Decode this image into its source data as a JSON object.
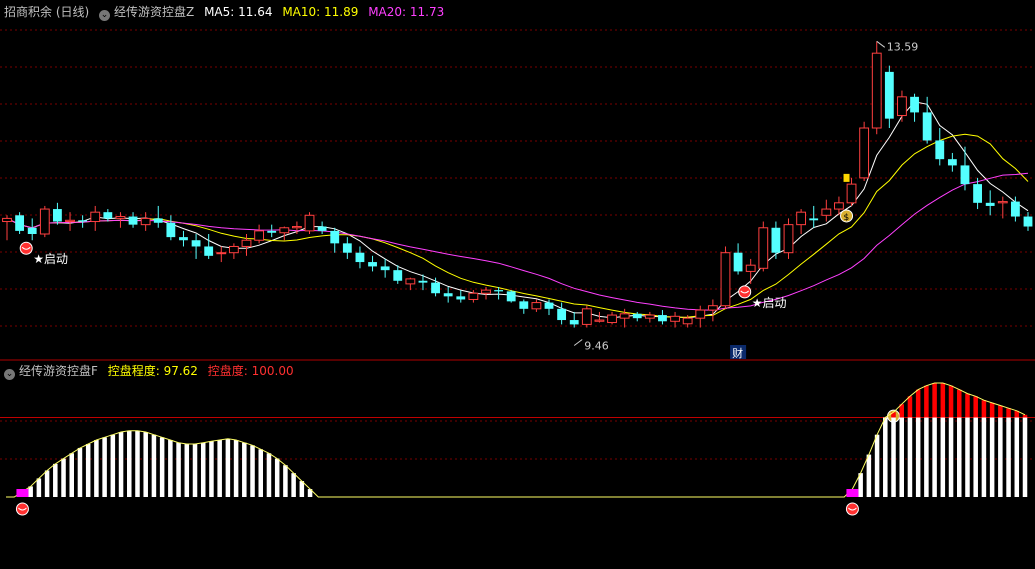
{
  "header_top": {
    "stock": "招商积余 (日线)",
    "indicator": "经传游资控盘Z",
    "ma5_label": "MA5: 11.64",
    "ma10_label": "MA10: 11.89",
    "ma20_label": "MA20: 11.73"
  },
  "header_bottom": {
    "indicator": "经传游资控盘F",
    "control_degree_label": "控盘程度: 97.62",
    "control_label": "控盘度: 100.00"
  },
  "colors": {
    "up": "#ff4040",
    "down": "#54ffff",
    "ma5": "#ffffff",
    "ma10": "#ffff00",
    "ma20": "#ff40ff",
    "grid": "#7a0000",
    "separator": "#b00000",
    "header_gray": "#c0c0c0",
    "header_yellow": "#ffff00",
    "header_red": "#ff3030",
    "bar_white": "#ffffff",
    "bar_red": "#ff0000",
    "bar_magenta": "#ff00ff",
    "line_yellow": "#ffff66"
  },
  "chart_data": [
    {
      "type": "candlestick",
      "title": "招商积余 (日线)",
      "series": [
        {
          "name": "MA5",
          "color": "#ffffff",
          "last": 11.64
        },
        {
          "name": "MA10",
          "color": "#ffff00",
          "last": 11.89
        },
        {
          "name": "MA20",
          "color": "#ff40ff",
          "last": 11.73
        }
      ],
      "ohlc": [
        [
          10.7,
          10.8,
          10.4,
          10.75
        ],
        [
          10.8,
          10.85,
          10.5,
          10.55
        ],
        [
          10.6,
          10.75,
          10.4,
          10.5
        ],
        [
          10.5,
          10.95,
          10.45,
          10.9
        ],
        [
          10.9,
          11.0,
          10.65,
          10.7
        ],
        [
          10.7,
          10.85,
          10.55,
          10.72
        ],
        [
          10.72,
          10.8,
          10.6,
          10.7
        ],
        [
          10.7,
          10.95,
          10.55,
          10.85
        ],
        [
          10.85,
          10.9,
          10.7,
          10.75
        ],
        [
          10.75,
          10.85,
          10.6,
          10.78
        ],
        [
          10.78,
          10.85,
          10.6,
          10.65
        ],
        [
          10.65,
          10.85,
          10.55,
          10.75
        ],
        [
          10.75,
          10.95,
          10.6,
          10.68
        ],
        [
          10.68,
          10.8,
          10.4,
          10.45
        ],
        [
          10.45,
          10.55,
          10.3,
          10.4
        ],
        [
          10.4,
          10.5,
          10.1,
          10.3
        ],
        [
          10.3,
          10.5,
          10.1,
          10.15
        ],
        [
          10.2,
          10.3,
          10.05,
          10.2
        ],
        [
          10.2,
          10.35,
          10.1,
          10.3
        ],
        [
          10.3,
          10.5,
          10.15,
          10.4
        ],
        [
          10.4,
          10.65,
          10.35,
          10.55
        ],
        [
          10.55,
          10.65,
          10.45,
          10.52
        ],
        [
          10.52,
          10.62,
          10.4,
          10.6
        ],
        [
          10.6,
          10.7,
          10.5,
          10.62
        ],
        [
          10.55,
          10.85,
          10.5,
          10.8
        ],
        [
          10.62,
          10.7,
          10.5,
          10.55
        ],
        [
          10.55,
          10.6,
          10.2,
          10.35
        ],
        [
          10.35,
          10.45,
          10.1,
          10.2
        ],
        [
          10.2,
          10.3,
          9.95,
          10.05
        ],
        [
          10.05,
          10.15,
          9.9,
          9.98
        ],
        [
          9.98,
          10.1,
          9.8,
          9.92
        ],
        [
          9.92,
          10.0,
          9.7,
          9.75
        ],
        [
          9.7,
          9.8,
          9.6,
          9.78
        ],
        [
          9.75,
          9.85,
          9.6,
          9.72
        ],
        [
          9.72,
          9.8,
          9.5,
          9.55
        ],
        [
          9.55,
          9.65,
          9.4,
          9.5
        ],
        [
          9.5,
          9.6,
          9.4,
          9.45
        ],
        [
          9.45,
          9.6,
          9.4,
          9.55
        ],
        [
          9.55,
          9.65,
          9.45,
          9.6
        ],
        [
          9.6,
          9.65,
          9.45,
          9.58
        ],
        [
          9.58,
          9.6,
          9.4,
          9.42
        ],
        [
          9.42,
          9.45,
          9.22,
          9.3
        ],
        [
          9.3,
          9.45,
          9.25,
          9.4
        ],
        [
          9.4,
          9.45,
          9.2,
          9.3
        ],
        [
          9.3,
          9.4,
          9.05,
          9.12
        ],
        [
          9.12,
          9.25,
          9.0,
          9.05
        ],
        [
          9.05,
          9.35,
          9.0,
          9.3
        ],
        [
          9.1,
          9.25,
          9.08,
          9.12
        ],
        [
          9.08,
          9.25,
          9.05,
          9.2
        ],
        [
          9.15,
          9.3,
          9.0,
          9.22
        ],
        [
          9.22,
          9.25,
          9.1,
          9.15
        ],
        [
          9.15,
          9.25,
          9.08,
          9.2
        ],
        [
          9.2,
          9.28,
          9.05,
          9.1
        ],
        [
          9.1,
          9.25,
          9.0,
          9.18
        ],
        [
          9.06,
          9.2,
          9.0,
          9.15
        ],
        [
          9.15,
          9.35,
          9.0,
          9.28
        ],
        [
          9.28,
          9.45,
          9.1,
          9.35
        ],
        [
          9.35,
          10.3,
          9.3,
          10.2
        ],
        [
          10.2,
          10.35,
          9.85,
          9.9
        ],
        [
          9.9,
          10.1,
          9.7,
          10.0
        ],
        [
          9.95,
          10.7,
          9.9,
          10.6
        ],
        [
          10.6,
          10.7,
          10.1,
          10.2
        ],
        [
          10.2,
          10.75,
          10.1,
          10.65
        ],
        [
          10.65,
          10.9,
          10.5,
          10.85
        ],
        [
          10.75,
          10.95,
          10.6,
          10.72
        ],
        [
          10.8,
          11.05,
          10.7,
          10.9
        ],
        [
          10.9,
          11.1,
          10.8,
          11.0
        ],
        [
          11.0,
          11.4,
          10.95,
          11.3
        ],
        [
          11.4,
          12.3,
          11.35,
          12.2
        ],
        [
          12.2,
          13.59,
          12.1,
          13.4
        ],
        [
          13.1,
          13.2,
          12.2,
          12.35
        ],
        [
          12.4,
          12.8,
          12.3,
          12.7
        ],
        [
          12.7,
          12.75,
          12.3,
          12.45
        ],
        [
          12.45,
          12.7,
          11.95,
          12.0
        ],
        [
          12.0,
          12.2,
          11.6,
          11.7
        ],
        [
          11.7,
          11.8,
          11.5,
          11.6
        ],
        [
          11.6,
          11.9,
          11.2,
          11.3
        ],
        [
          11.3,
          11.4,
          10.9,
          11.0
        ],
        [
          11.0,
          11.2,
          10.8,
          10.95
        ],
        [
          11.0,
          11.1,
          10.75,
          11.02
        ],
        [
          11.02,
          11.1,
          10.7,
          10.78
        ],
        [
          10.78,
          10.85,
          10.55,
          10.62
        ]
      ],
      "high_label": "13.59",
      "low_label": "9.46",
      "signal_label": "启动",
      "finance_marker": "财"
    },
    {
      "type": "bar",
      "title": "经传游资控盘F",
      "series": [
        {
          "name": "控盘程度",
          "value": 97.62
        },
        {
          "name": "控盘度",
          "value": 100.0
        }
      ],
      "threshold": 60,
      "values": [
        0,
        0,
        4,
        8,
        14,
        20,
        25,
        29,
        33,
        37,
        40,
        43,
        45,
        47,
        49,
        50,
        50,
        49,
        47,
        45,
        43,
        41,
        40,
        40,
        41,
        42,
        43,
        44,
        43,
        41,
        39,
        36,
        33,
        29,
        24,
        18,
        12,
        6,
        0,
        0,
        0,
        0,
        0,
        0,
        0,
        0,
        0,
        0,
        0,
        0,
        0,
        0,
        0,
        0,
        0,
        0,
        0,
        0,
        0,
        0,
        0,
        0,
        0,
        0,
        0,
        0,
        0,
        0,
        0,
        0,
        0,
        0,
        0,
        0,
        0,
        0,
        0,
        0,
        0,
        0,
        0,
        0,
        0,
        0,
        0,
        0,
        0,
        0,
        0,
        0,
        0,
        0,
        0,
        0,
        0,
        0,
        0,
        0,
        0,
        0,
        0,
        0,
        0,
        6,
        18,
        32,
        47,
        60,
        64,
        70,
        76,
        81,
        84,
        86,
        86,
        84,
        81,
        78,
        76,
        73,
        71,
        69,
        67,
        65,
        62
      ],
      "markers": [
        {
          "x": 2,
          "color": "magenta"
        },
        {
          "x": 103,
          "color": "magenta"
        }
      ]
    }
  ]
}
